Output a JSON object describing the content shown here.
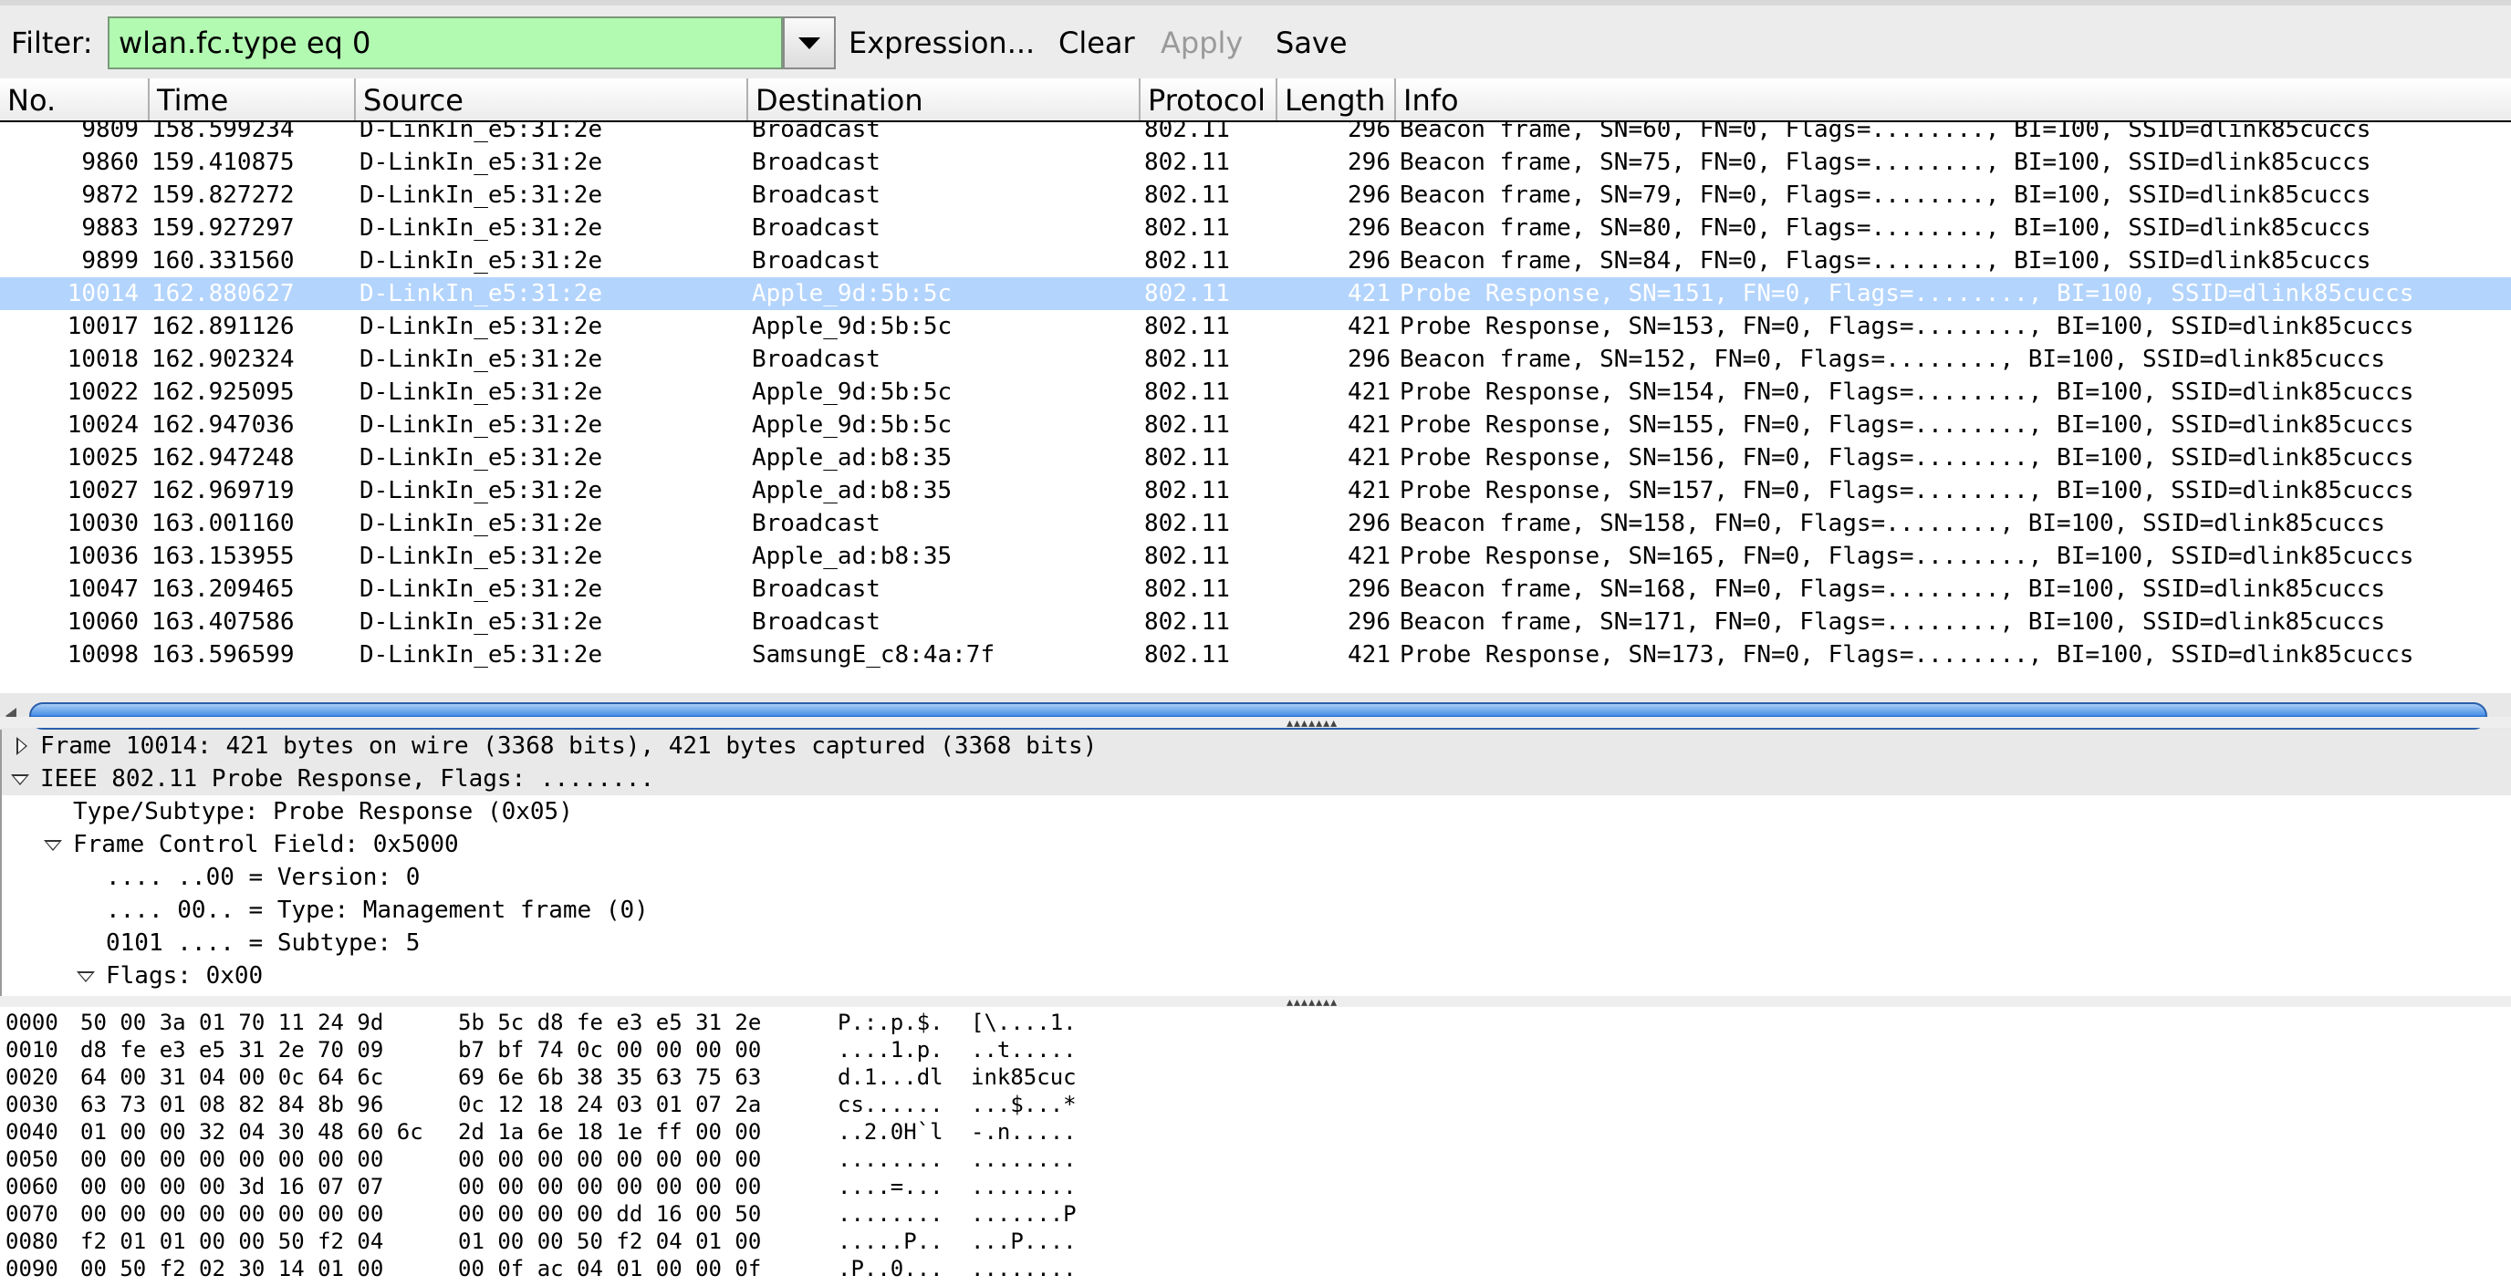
{
  "filter": {
    "label": "Filter:",
    "value": "wlan.fc.type eq 0",
    "expression_label": "Expression...",
    "clear_label": "Clear",
    "apply_label": "Apply",
    "save_label": "Save"
  },
  "columns": [
    "No.",
    "Time",
    "Source",
    "Destination",
    "Protocol",
    "Length",
    "Info"
  ],
  "packets": [
    {
      "no": "9809",
      "time": "158.599234",
      "src": "D-LinkIn_e5:31:2e",
      "dst": "Broadcast",
      "proto": "802.11",
      "len": "296",
      "info": "Beacon frame, SN=60, FN=0, Flags=........, BI=100, SSID=dlink85cuccs"
    },
    {
      "no": "9860",
      "time": "159.410875",
      "src": "D-LinkIn_e5:31:2e",
      "dst": "Broadcast",
      "proto": "802.11",
      "len": "296",
      "info": "Beacon frame, SN=75, FN=0, Flags=........, BI=100, SSID=dlink85cuccs"
    },
    {
      "no": "9872",
      "time": "159.827272",
      "src": "D-LinkIn_e5:31:2e",
      "dst": "Broadcast",
      "proto": "802.11",
      "len": "296",
      "info": "Beacon frame, SN=79, FN=0, Flags=........, BI=100, SSID=dlink85cuccs"
    },
    {
      "no": "9883",
      "time": "159.927297",
      "src": "D-LinkIn_e5:31:2e",
      "dst": "Broadcast",
      "proto": "802.11",
      "len": "296",
      "info": "Beacon frame, SN=80, FN=0, Flags=........, BI=100, SSID=dlink85cuccs"
    },
    {
      "no": "9899",
      "time": "160.331560",
      "src": "D-LinkIn_e5:31:2e",
      "dst": "Broadcast",
      "proto": "802.11",
      "len": "296",
      "info": "Beacon frame, SN=84, FN=0, Flags=........, BI=100, SSID=dlink85cuccs"
    },
    {
      "no": "10014",
      "time": "162.880627",
      "src": "D-LinkIn_e5:31:2e",
      "dst": "Apple_9d:5b:5c",
      "proto": "802.11",
      "len": "421",
      "info": "Probe Response, SN=151, FN=0, Flags=........, BI=100, SSID=dlink85cuccs",
      "selected": true
    },
    {
      "no": "10017",
      "time": "162.891126",
      "src": "D-LinkIn_e5:31:2e",
      "dst": "Apple_9d:5b:5c",
      "proto": "802.11",
      "len": "421",
      "info": "Probe Response, SN=153, FN=0, Flags=........, BI=100, SSID=dlink85cuccs"
    },
    {
      "no": "10018",
      "time": "162.902324",
      "src": "D-LinkIn_e5:31:2e",
      "dst": "Broadcast",
      "proto": "802.11",
      "len": "296",
      "info": "Beacon frame, SN=152, FN=0, Flags=........, BI=100, SSID=dlink85cuccs"
    },
    {
      "no": "10022",
      "time": "162.925095",
      "src": "D-LinkIn_e5:31:2e",
      "dst": "Apple_9d:5b:5c",
      "proto": "802.11",
      "len": "421",
      "info": "Probe Response, SN=154, FN=0, Flags=........, BI=100, SSID=dlink85cuccs"
    },
    {
      "no": "10024",
      "time": "162.947036",
      "src": "D-LinkIn_e5:31:2e",
      "dst": "Apple_9d:5b:5c",
      "proto": "802.11",
      "len": "421",
      "info": "Probe Response, SN=155, FN=0, Flags=........, BI=100, SSID=dlink85cuccs"
    },
    {
      "no": "10025",
      "time": "162.947248",
      "src": "D-LinkIn_e5:31:2e",
      "dst": "Apple_ad:b8:35",
      "proto": "802.11",
      "len": "421",
      "info": "Probe Response, SN=156, FN=0, Flags=........, BI=100, SSID=dlink85cuccs"
    },
    {
      "no": "10027",
      "time": "162.969719",
      "src": "D-LinkIn_e5:31:2e",
      "dst": "Apple_ad:b8:35",
      "proto": "802.11",
      "len": "421",
      "info": "Probe Response, SN=157, FN=0, Flags=........, BI=100, SSID=dlink85cuccs"
    },
    {
      "no": "10030",
      "time": "163.001160",
      "src": "D-LinkIn_e5:31:2e",
      "dst": "Broadcast",
      "proto": "802.11",
      "len": "296",
      "info": "Beacon frame, SN=158, FN=0, Flags=........, BI=100, SSID=dlink85cuccs"
    },
    {
      "no": "10036",
      "time": "163.153955",
      "src": "D-LinkIn_e5:31:2e",
      "dst": "Apple_ad:b8:35",
      "proto": "802.11",
      "len": "421",
      "info": "Probe Response, SN=165, FN=0, Flags=........, BI=100, SSID=dlink85cuccs"
    },
    {
      "no": "10047",
      "time": "163.209465",
      "src": "D-LinkIn_e5:31:2e",
      "dst": "Broadcast",
      "proto": "802.11",
      "len": "296",
      "info": "Beacon frame, SN=168, FN=0, Flags=........, BI=100, SSID=dlink85cuccs"
    },
    {
      "no": "10060",
      "time": "163.407586",
      "src": "D-LinkIn_e5:31:2e",
      "dst": "Broadcast",
      "proto": "802.11",
      "len": "296",
      "info": "Beacon frame, SN=171, FN=0, Flags=........, BI=100, SSID=dlink85cuccs"
    },
    {
      "no": "10098",
      "time": "163.596599",
      "src": "D-LinkIn_e5:31:2e",
      "dst": "SamsungE_c8:4a:7f",
      "proto": "802.11",
      "len": "421",
      "info": "Probe Response, SN=173, FN=0, Flags=........, BI=100, SSID=dlink85cuccs"
    }
  ],
  "details": [
    {
      "text": "Frame 10014: 421 bytes on wire (3368 bits), 421 bytes captured (3368 bits)",
      "level": 0,
      "expander": "collapsed",
      "shaded": true
    },
    {
      "text": "IEEE 802.11 Probe Response, Flags: ........",
      "level": 0,
      "expander": "expanded",
      "shaded": true
    },
    {
      "text": "Type/Subtype: Probe Response (0x05)",
      "level": 1,
      "expander": "none"
    },
    {
      "text": "Frame Control Field: 0x5000",
      "level": 1,
      "expander": "expanded"
    },
    {
      "text": ".... ..00 = Version: 0",
      "level": 2,
      "expander": "none"
    },
    {
      "text": ".... 00.. = Type: Management frame (0)",
      "level": 2,
      "expander": "none"
    },
    {
      "text": "0101 .... = Subtype: 5",
      "level": 2,
      "expander": "none"
    },
    {
      "text": "Flags: 0x00",
      "level": 2,
      "expander": "expanded"
    }
  ],
  "hex": [
    {
      "off": "0000",
      "b1": "50 00 3a 01 70 11 24 9d",
      "b2": "5b 5c d8 fe e3 e5 31 2e",
      "a1": "P.:.p.$.",
      "a2": "[\\....1."
    },
    {
      "off": "0010",
      "b1": "d8 fe e3 e5 31 2e 70 09",
      "b2": "b7 bf 74 0c 00 00 00 00",
      "a1": "....1.p.",
      "a2": "..t....."
    },
    {
      "off": "0020",
      "b1": "64 00 31 04 00 0c 64 6c",
      "b2": "69 6e 6b 38 35 63 75 63",
      "a1": "d.1...dl",
      "a2": "ink85cuc"
    },
    {
      "off": "0030",
      "b1": "63 73 01 08 82 84 8b 96",
      "b2": "0c 12 18 24 03 01 07 2a",
      "a1": "cs......",
      "a2": "...$...*"
    },
    {
      "off": "0040",
      "b1": "01 00 00 32 04 30 48 60 6c",
      "b2": "2d 1a 6e 18 1e ff 00 00",
      "a1": "..2.0H`l",
      "a2": "-.n....."
    },
    {
      "off": "0050",
      "b1": "00 00 00 00 00 00 00 00",
      "b2": "00 00 00 00 00 00 00 00",
      "a1": "........",
      "a2": "........"
    },
    {
      "off": "0060",
      "b1": "00 00 00 00 3d 16 07 07",
      "b2": "00 00 00 00 00 00 00 00",
      "a1": "....=...",
      "a2": "........"
    },
    {
      "off": "0070",
      "b1": "00 00 00 00 00 00 00 00",
      "b2": "00 00 00 00 dd 16 00 50",
      "a1": "........",
      "a2": ".......P"
    },
    {
      "off": "0080",
      "b1": "f2 01 01 00 00 50 f2 04",
      "b2": "01 00 00 50 f2 04 01 00",
      "a1": ".....P..",
      "a2": "...P...."
    },
    {
      "off": "0090",
      "b1": "00 50 f2 02 30 14 01 00",
      "b2": "00 0f ac 04 01 00 00 0f",
      "a1": ".P..0...",
      "a2": "........"
    }
  ]
}
